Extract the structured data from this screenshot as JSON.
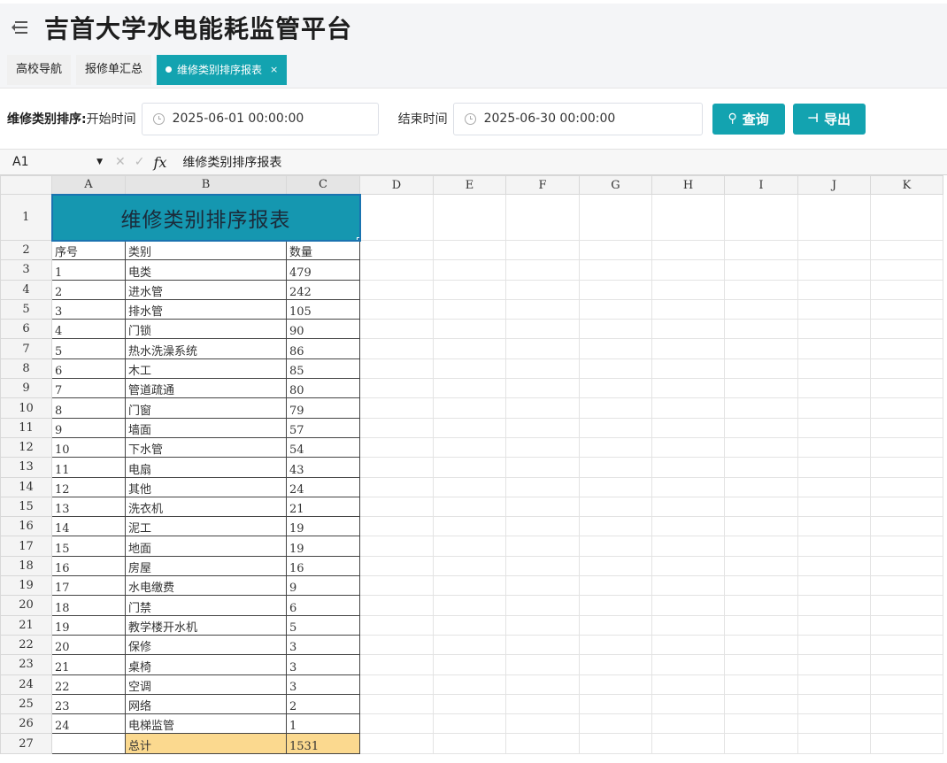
{
  "header": {
    "title": "吉首大学水电能耗监管平台",
    "menu_icon": "menu-fold-icon"
  },
  "tabs": [
    {
      "label": "高校导航",
      "active": false
    },
    {
      "label": "报修单汇总",
      "active": false
    },
    {
      "label": "维修类别排序报表",
      "active": true,
      "close": "×"
    }
  ],
  "filters": {
    "section_label": "维修类别排序:",
    "start_label": "开始时间",
    "start_value": "2025-06-01 00:00:00",
    "end_label": "结束时间",
    "end_value": "2025-06-30 00:00:00",
    "query_label": "查询",
    "export_label": "导出"
  },
  "formula_bar": {
    "cell_ref": "A1",
    "fx": "fx",
    "content": "维修类别排序报表"
  },
  "sheet": {
    "columns": [
      "A",
      "B",
      "C",
      "D",
      "E",
      "F",
      "G",
      "H",
      "I",
      "J",
      "K"
    ],
    "title": "维修类别排序报表",
    "headers": [
      "序号",
      "类别",
      "数量"
    ],
    "rows": [
      [
        "1",
        "电类",
        "479"
      ],
      [
        "2",
        "进水管",
        "242"
      ],
      [
        "3",
        "排水管",
        "105"
      ],
      [
        "4",
        "门锁",
        "90"
      ],
      [
        "5",
        "热水洗澡系统",
        "86"
      ],
      [
        "6",
        "木工",
        "85"
      ],
      [
        "7",
        "管道疏通",
        "80"
      ],
      [
        "8",
        "门窗",
        "79"
      ],
      [
        "9",
        "墙面",
        "57"
      ],
      [
        "10",
        "下水管",
        "54"
      ],
      [
        "11",
        "电扇",
        "43"
      ],
      [
        "12",
        "其他",
        "24"
      ],
      [
        "13",
        "洗衣机",
        "21"
      ],
      [
        "14",
        "泥工",
        "19"
      ],
      [
        "15",
        "地面",
        "19"
      ],
      [
        "16",
        "房屋",
        "16"
      ],
      [
        "17",
        "水电缴费",
        "9"
      ],
      [
        "18",
        "门禁",
        "6"
      ],
      [
        "19",
        "教学楼开水机",
        "5"
      ],
      [
        "20",
        "保修",
        "3"
      ],
      [
        "21",
        "桌椅",
        "3"
      ],
      [
        "22",
        "空调",
        "3"
      ],
      [
        "23",
        "网络",
        "2"
      ],
      [
        "24",
        "电梯监管",
        "1"
      ]
    ],
    "total_label": "总计",
    "total_value": "1531",
    "colors": {
      "title_fill": "#1597b0",
      "selection": "#1a73b0",
      "total_fill": "#fbd98f",
      "accent": "#13a3b0"
    }
  }
}
